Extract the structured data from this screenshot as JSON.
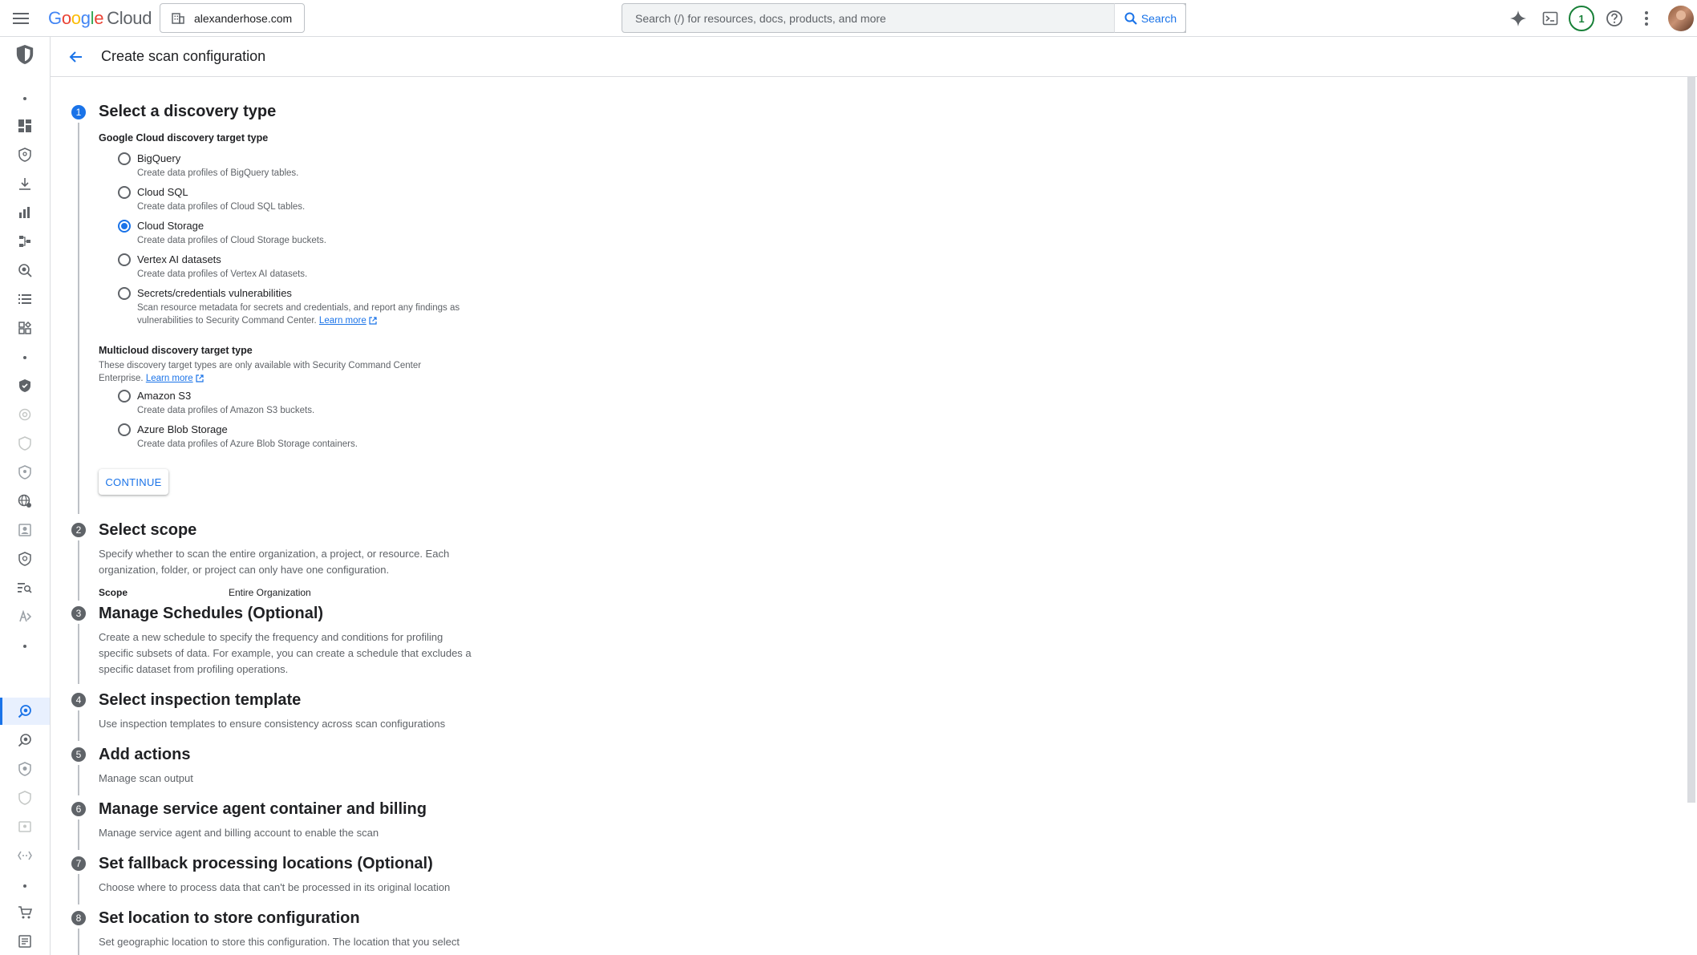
{
  "topbar": {
    "brand": {
      "letters": [
        "G",
        "o",
        "o",
        "g",
        "l",
        "e"
      ],
      "product": "Cloud"
    },
    "org": "alexanderhose.com",
    "search_placeholder": "Search (/) for resources, docs, products, and more",
    "search_button": "Search",
    "notification_count": "1",
    "icons": [
      "menu-icon",
      "gemini-icon",
      "cloud-shell-icon",
      "notifications-icon",
      "help-icon",
      "more-vert-icon",
      "avatar"
    ]
  },
  "header": {
    "title": "Create scan configuration"
  },
  "steps": [
    {
      "number": "1",
      "title": "Select a discovery type"
    },
    {
      "number": "2",
      "title": "Select scope",
      "description": "Specify whether to scan the entire organization, a project, or resource. Each organization, folder, or project can only have one configuration."
    },
    {
      "number": "3",
      "title": "Manage Schedules (Optional)",
      "description": "Create a new schedule to specify the frequency and conditions for profiling specific subsets of data. For example, you can create a schedule that excludes a specific dataset from profiling operations."
    },
    {
      "number": "4",
      "title": "Select inspection template",
      "description": "Use inspection templates to ensure consistency across scan configurations"
    },
    {
      "number": "5",
      "title": "Add actions",
      "description": "Manage scan output"
    },
    {
      "number": "6",
      "title": "Manage service agent container and billing",
      "description": "Manage service agent and billing account to enable the scan"
    },
    {
      "number": "7",
      "title": "Set fallback processing locations (Optional)",
      "description": "Choose where to process data that can't be processed in its original location"
    },
    {
      "number": "8",
      "title": "Set location to store configuration",
      "description": "Set geographic location to store this configuration. The location that you select"
    }
  ],
  "discovery": {
    "gcp_label": "Google Cloud discovery target type",
    "options": [
      {
        "label": "BigQuery",
        "desc": "Create data profiles of BigQuery tables.",
        "checked": false
      },
      {
        "label": "Cloud SQL",
        "desc": "Create data profiles of Cloud SQL tables.",
        "checked": false
      },
      {
        "label": "Cloud Storage",
        "desc": "Create data profiles of Cloud Storage buckets.",
        "checked": true
      },
      {
        "label": "Vertex AI datasets",
        "desc": "Create data profiles of Vertex AI datasets.",
        "checked": false
      },
      {
        "label": "Secrets/credentials vulnerabilities",
        "desc": "Scan resource metadata for secrets and credentials, and report any findings as vulnerabilities to Security Command Center.",
        "link": "Learn more",
        "checked": false
      }
    ],
    "multicloud_label": "Multicloud discovery target type",
    "multicloud_desc": "These discovery target types are only available with Security Command Center Enterprise.",
    "multicloud_link": "Learn more",
    "multicloud_options": [
      {
        "label": "Amazon S3",
        "desc": "Create data profiles of Amazon S3 buckets.",
        "checked": false
      },
      {
        "label": "Azure Blob Storage",
        "desc": "Create data profiles of Azure Blob Storage containers.",
        "checked": false
      }
    ],
    "continue_label": "CONTINUE"
  },
  "scope": {
    "key": "Scope",
    "value": "Entire Organization"
  },
  "colors": {
    "accent": "#1a73e8",
    "step_inactive": "#5f6368",
    "border": "#dadce0"
  }
}
